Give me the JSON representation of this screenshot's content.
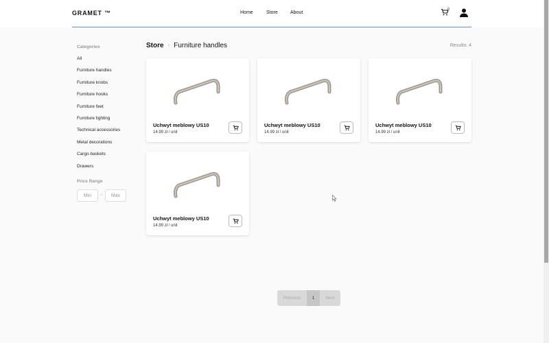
{
  "header": {
    "logo": "GRAMET ™",
    "nav": [
      "Home",
      "Store",
      "About"
    ],
    "cart_count": "0"
  },
  "sidebar": {
    "categories_title": "Categories",
    "categories": [
      "All",
      "Furniture handles",
      "Furniture knobs",
      "Furniture hooks",
      "Furniture feet",
      "Furniture lighting",
      "Technical accessories",
      "Metal decorations",
      "Cargo baskets",
      "Drawers"
    ],
    "price_title": "Price Range",
    "min_placeholder": "Min",
    "max_placeholder": "Max",
    "dash": "-"
  },
  "main": {
    "breadcrumb_root": "Store",
    "breadcrumb_sep": "›",
    "breadcrumb_current": "Furniture handles",
    "results": "Results: 4",
    "products": [
      {
        "name": "Uchwyt meblowy US10",
        "price": "14.99 zł / unit"
      },
      {
        "name": "Uchwyt meblowy US10",
        "price": "14.99 zł / unit"
      },
      {
        "name": "Uchwyt meblowy US10",
        "price": "14.99 zł / unit"
      },
      {
        "name": "Uchwyt meblowy US10",
        "price": "14.99 zł / unit"
      }
    ]
  },
  "pagination": {
    "previous": "Previous",
    "page": "1",
    "next": "Next"
  },
  "icons": {
    "cart": "cart-icon",
    "user": "user-icon",
    "add_to_cart": "add-to-cart-icon"
  }
}
